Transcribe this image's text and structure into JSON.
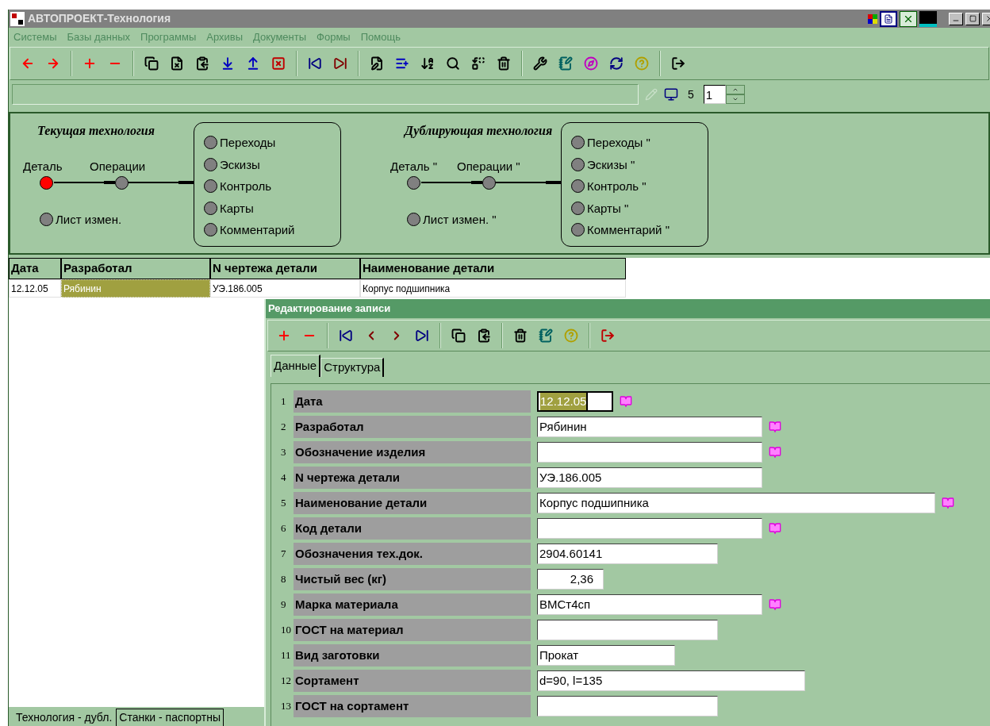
{
  "window": {
    "title": "АВТОПРОЕКТ-Технология"
  },
  "menu": [
    "Системы",
    "Базы данных",
    "Программы",
    "Архивы",
    "Документы",
    "Формы",
    "Помощь"
  ],
  "statusbar": {
    "count": "5",
    "spinner_value": "1"
  },
  "current": {
    "title": "Текущая технология",
    "chain": [
      {
        "label": "Деталь",
        "selected": true
      },
      {
        "label": "Операции",
        "selected": false
      }
    ],
    "change_list": {
      "label": "Лист измен.",
      "selected": false
    },
    "items": [
      {
        "label": "Переходы",
        "selected": false
      },
      {
        "label": "Эскизы",
        "selected": false
      },
      {
        "label": "Контроль",
        "selected": false
      },
      {
        "label": "Карты",
        "selected": false
      },
      {
        "label": "Комментарий",
        "selected": false
      }
    ]
  },
  "duplicate": {
    "title": "Дублирующая технология",
    "chain": [
      {
        "label": "Деталь \"",
        "selected": false
      },
      {
        "label": "Операции \"",
        "selected": false
      }
    ],
    "change_list": {
      "label": "Лист измен. \"",
      "selected": false
    },
    "items": [
      {
        "label": "Переходы \"",
        "selected": false
      },
      {
        "label": "Эскизы \"",
        "selected": false
      },
      {
        "label": "Контроль \"",
        "selected": false
      },
      {
        "label": "Карты \"",
        "selected": false
      },
      {
        "label": "Комментарий \"",
        "selected": false
      }
    ]
  },
  "table": {
    "columns": [
      "Дата",
      "Разработал",
      "N чертежа детали",
      "Наименование детали"
    ],
    "rows": [
      {
        "cells": [
          {
            "text": "12.12.05",
            "selected": false
          },
          {
            "text": "Рябинин",
            "selected": true
          },
          {
            "text": "УЭ.186.005",
            "selected": false
          },
          {
            "text": "Корпус подшипника",
            "selected": false
          }
        ]
      }
    ]
  },
  "bottom_tabs": [
    {
      "label": "Технология - дубл.",
      "selected": false
    },
    {
      "label": "Станки - паспортны",
      "selected": true
    }
  ],
  "dialog": {
    "title": "Редактирование записи",
    "tabs": [
      {
        "label": "Данные",
        "selected": true
      },
      {
        "label": "Структура",
        "selected": false
      }
    ],
    "fields": [
      {
        "number": "1",
        "label": "Дата",
        "value": "12.12.05",
        "lookup": true,
        "selected": true
      },
      {
        "number": "2",
        "label": "Разработал",
        "value": "Рябинин",
        "lookup": true,
        "selected": false
      },
      {
        "number": "3",
        "label": "Обозначение изделия",
        "lookup": true,
        "selected": false
      },
      {
        "number": "4",
        "label": "N чертежа детали",
        "value": "УЭ.186.005",
        "lookup": false,
        "selected": false
      },
      {
        "number": "5",
        "label": "Наименование детали",
        "value": "Корпус подшипника",
        "lookup": true,
        "selected": false
      },
      {
        "number": "6",
        "label": "Код детали",
        "lookup": true,
        "selected": false
      },
      {
        "number": "7",
        "label": "Обозначения тех.док.",
        "value": "2904.60141",
        "lookup": false,
        "selected": false
      },
      {
        "number": "8",
        "label": "Чистый вес (кг)",
        "value": "2,36",
        "lookup": false,
        "selected": false
      },
      {
        "number": "9",
        "label": "Марка материала",
        "value": "ВМСт4сп",
        "lookup": true,
        "selected": false
      },
      {
        "number": "10",
        "label": "ГОСТ на материал",
        "lookup": false,
        "selected": false
      },
      {
        "number": "11",
        "label": "Вид заготовки",
        "value": "Прокат",
        "lookup": false,
        "selected": false
      },
      {
        "number": "12",
        "label": "Сортамент",
        "value": "d=90, l=135",
        "lookup": false,
        "selected": false
      },
      {
        "number": "13",
        "label": "ГОСТ на сортамент",
        "lookup": false,
        "selected": false
      }
    ]
  }
}
